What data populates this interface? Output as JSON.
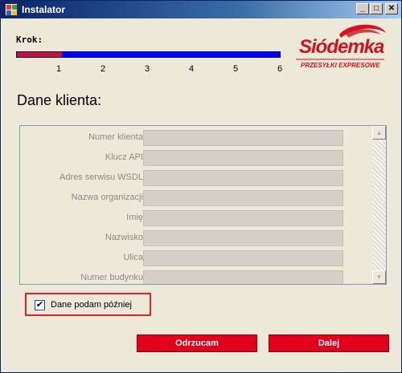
{
  "window": {
    "title": "Instalator",
    "controls": {
      "minimize": "_",
      "maximize": "□",
      "close": "✕"
    }
  },
  "steps": {
    "label": "Krok:",
    "numbers": [
      "1",
      "2",
      "3",
      "4",
      "5",
      "6"
    ],
    "current": 1,
    "total": 6,
    "progress_fraction": 0.17
  },
  "logo": {
    "brand": "Siódemka",
    "subtitle": "PRZESYŁKI EXPRESOWE"
  },
  "section": {
    "title": "Dane klienta:"
  },
  "form": {
    "fields": [
      {
        "label": "Numer klienta:",
        "value": ""
      },
      {
        "label": "Klucz API:",
        "value": ""
      },
      {
        "label": "Adres serwisu WSDL:",
        "value": ""
      },
      {
        "label": "Nazwa organizacji:",
        "value": ""
      },
      {
        "label": "Imię:",
        "value": ""
      },
      {
        "label": "Nazwisko:",
        "value": ""
      },
      {
        "label": "Ulica:",
        "value": ""
      },
      {
        "label": "Numer budynku:",
        "value": ""
      }
    ]
  },
  "later": {
    "label": "Dane podam później",
    "checked": true,
    "check_mark": "✔"
  },
  "buttons": {
    "reject": "Odrzucam",
    "next": "Dalej"
  },
  "colors": {
    "accent_red": "#e0001b",
    "progress_blue": "#0000ff",
    "progress_done": "#cc1122",
    "logo_red": "#d2121f"
  }
}
